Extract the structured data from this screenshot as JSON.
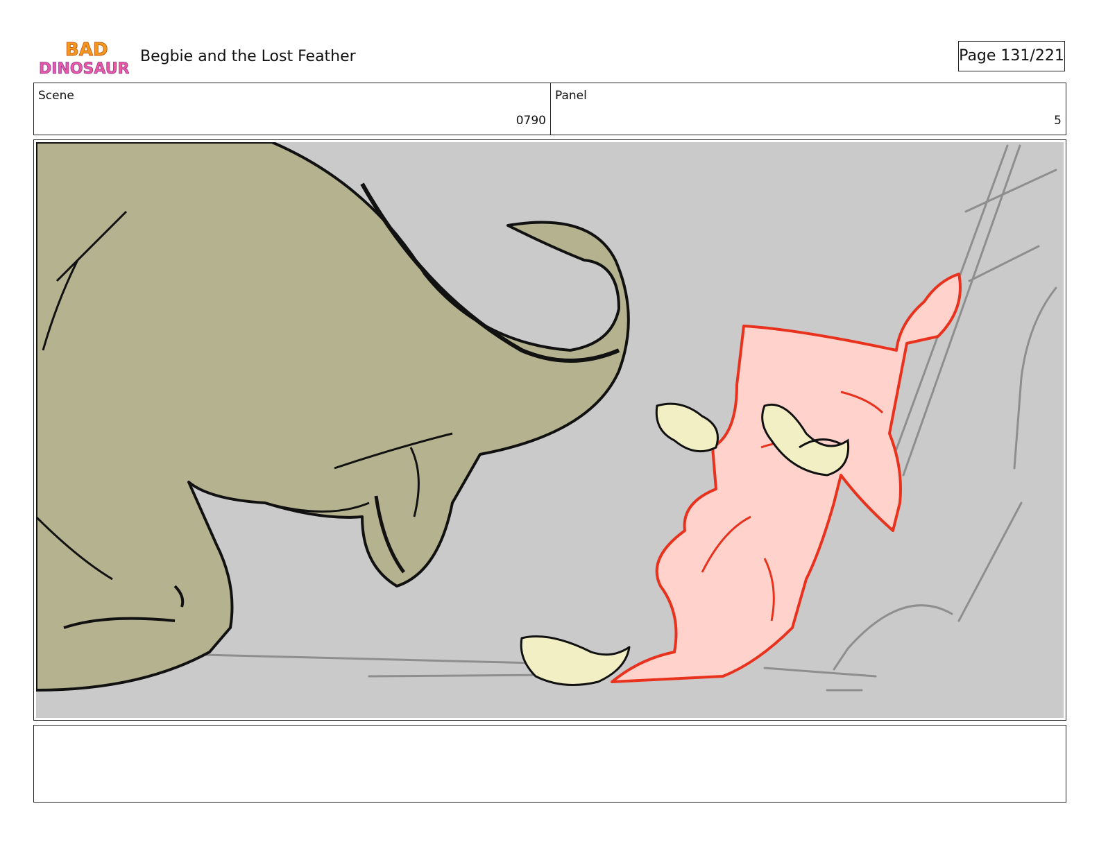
{
  "header": {
    "logo_text": "BAD DINOSAURS",
    "title": "Begbie and the Lost Feather",
    "page": "Page 131/221"
  },
  "info": {
    "scene_label": "Scene",
    "scene_value": "0790",
    "panel_label": "Panel",
    "panel_value": "5"
  },
  "frame": {
    "background_color": "#cacaca",
    "dino_color": "#b5b38f",
    "character_color": "#ffd3cc",
    "character_line_color": "#e8321e",
    "feather_color": "#f3efc4"
  },
  "notes": {
    "text": ""
  }
}
